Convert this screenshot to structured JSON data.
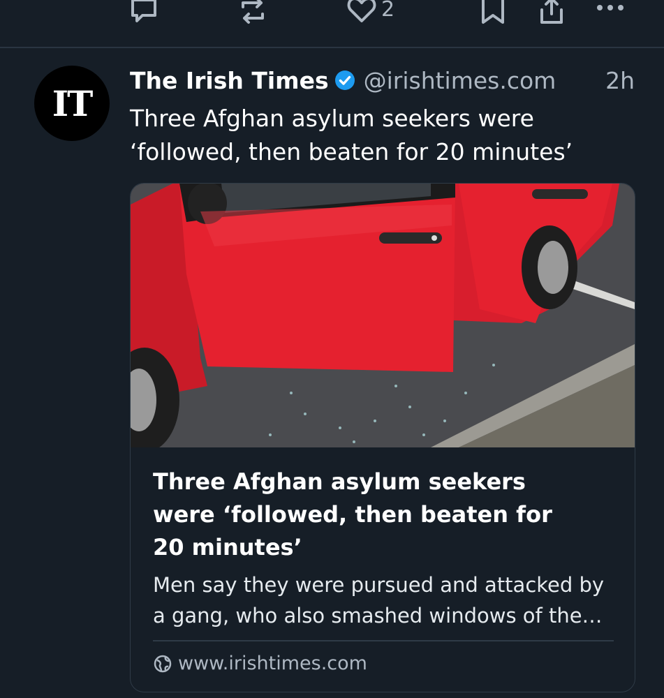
{
  "actions": {
    "reply_icon": "reply-icon",
    "repost_icon": "repost-icon",
    "like_icon": "like-icon",
    "like_count": "2",
    "bookmark_icon": "bookmark-icon",
    "share_icon": "share-icon",
    "more_icon": "more-icon"
  },
  "post": {
    "avatar_text": "IT",
    "author_name": "The Irish Times",
    "handle": "@irishtimes.com",
    "time": "2h",
    "text": "Three Afghan asylum seekers were ‘followed, then beaten for 20 minutes’"
  },
  "card": {
    "title": "Three Afghan asylum seekers were ‘followed, then beaten for 20 minutes’",
    "description": "Men say they were pursued and attacked by a gang, who also smashed windows of the…",
    "link": "www.irishtimes.com"
  },
  "colors": {
    "background": "#161e27",
    "verified": "#1d9bf0",
    "muted": "#aeb8c3",
    "car_red": "#e5212f"
  }
}
